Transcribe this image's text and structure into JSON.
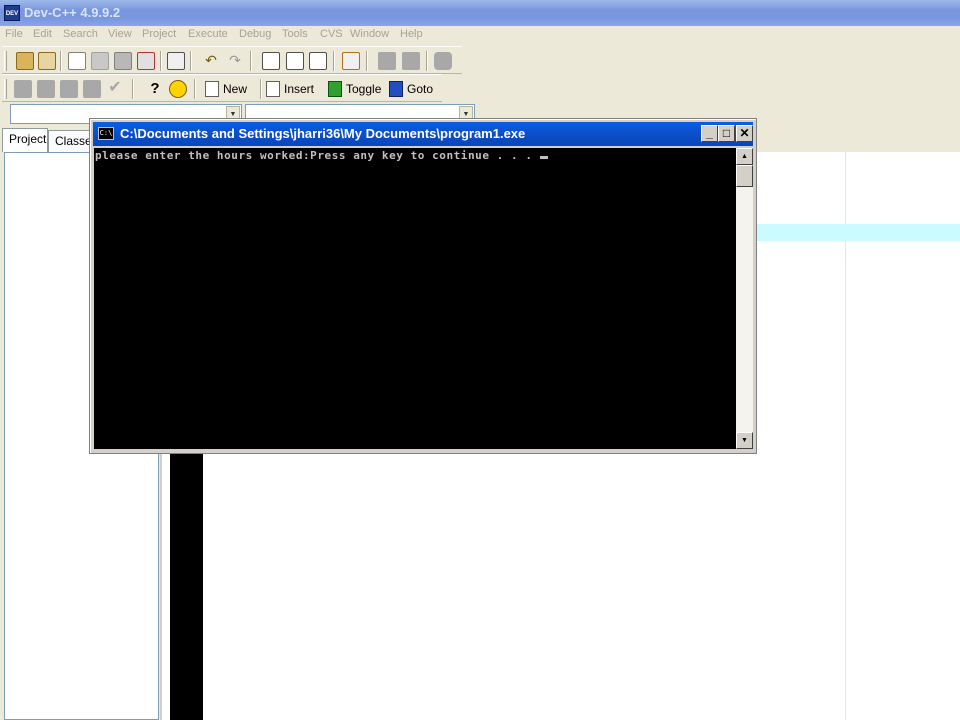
{
  "app": {
    "icon_text": "DEV",
    "title": "Dev-C++ 4.9.9.2"
  },
  "menu": [
    "File",
    "Edit",
    "Search",
    "View",
    "Project",
    "Execute",
    "Debug",
    "Tools",
    "CVS",
    "Window",
    "Help"
  ],
  "toolbar2": {
    "new_label": "New",
    "insert_label": "Insert",
    "toggle_label": "Toggle",
    "goto_label": "Goto"
  },
  "left_panel": {
    "tabs": [
      "Project",
      "Classes"
    ]
  },
  "console": {
    "icon_text": "C:\\",
    "title": "C:\\Documents and Settings\\jharri36\\My Documents\\program1.exe",
    "output": "please enter the hours worked:Press any key to continue . . . "
  },
  "colors": {
    "console_title": "#0b4fc9",
    "editor_highlight": "#cbfbfe",
    "gutter": "#000000"
  }
}
